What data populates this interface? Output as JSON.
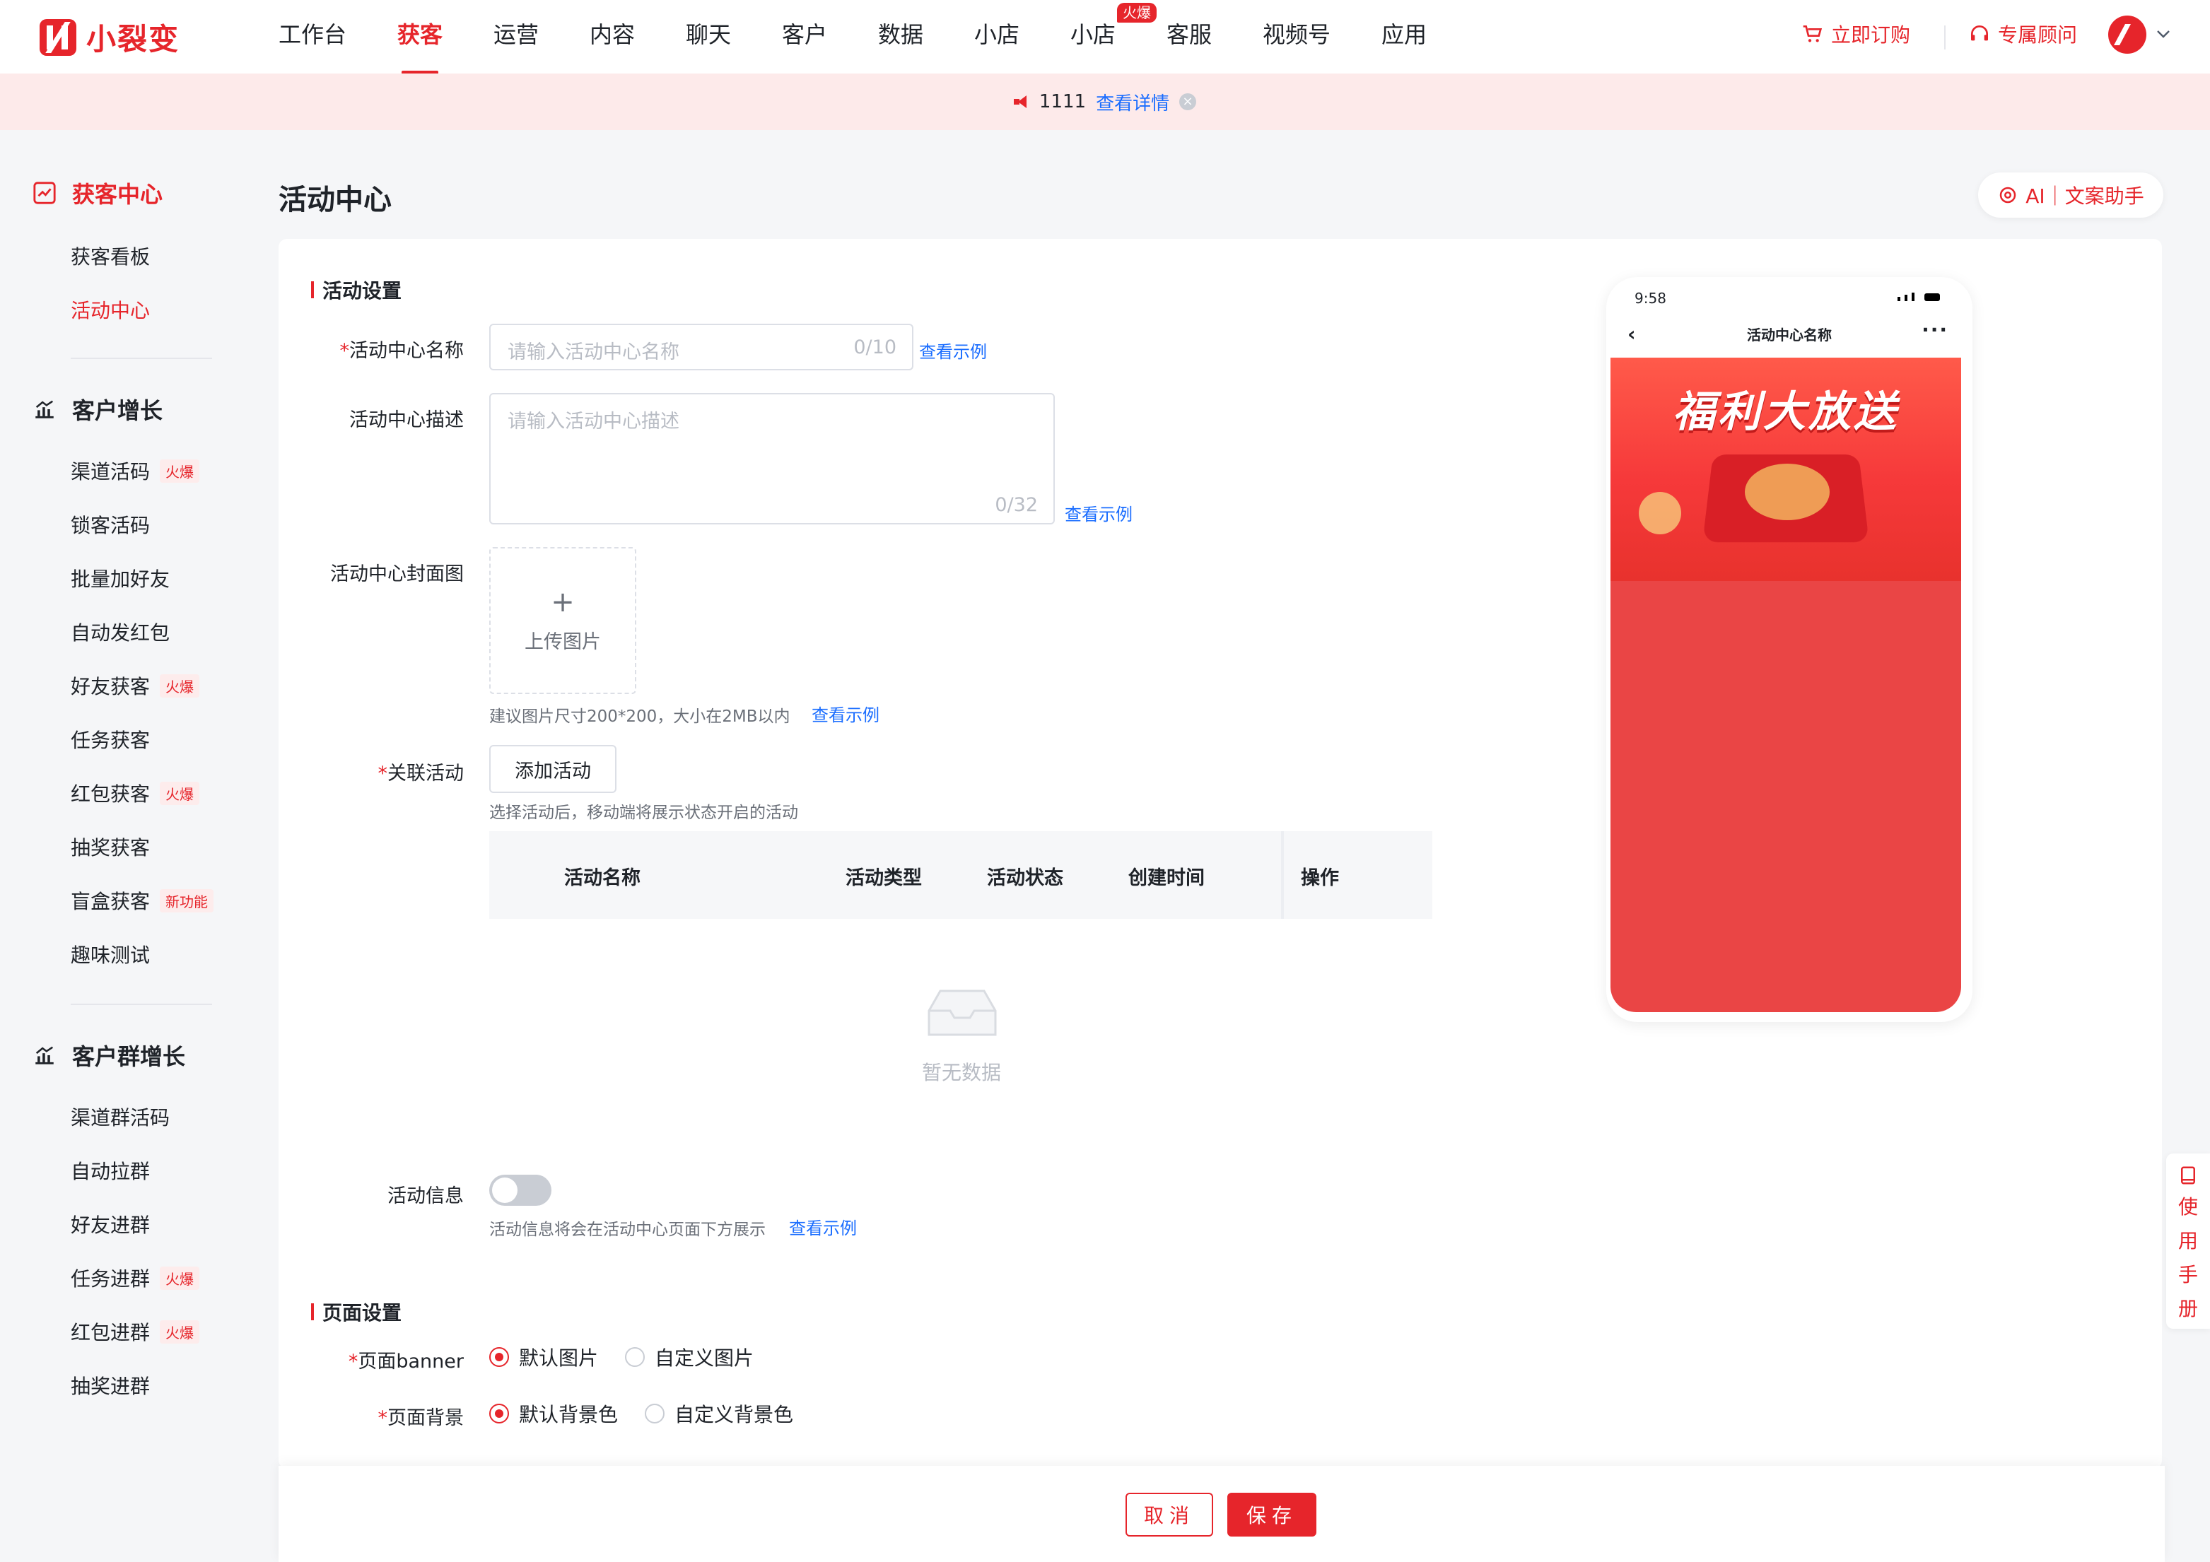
{
  "brand": {
    "name": "小裂变",
    "color": "#e6252b"
  },
  "nav": {
    "items": [
      "工作台",
      "获客",
      "运营",
      "内容",
      "聊天",
      "客户",
      "数据",
      "小店",
      "小店",
      "客服",
      "视频号",
      "应用"
    ],
    "active": "获客",
    "hot_badge": "火爆",
    "subscribe": "立即订购",
    "consultant": "专属顾问"
  },
  "notice": {
    "text": "1111",
    "link": "查看详情"
  },
  "sidebar": {
    "groups": [
      {
        "title": "获客中心",
        "items": [
          {
            "label": "获客看板"
          },
          {
            "label": "活动中心"
          }
        ]
      },
      {
        "title": "客户增长",
        "items": [
          {
            "label": "渠道活码",
            "tag": "火爆"
          },
          {
            "label": "锁客活码"
          },
          {
            "label": "批量加好友"
          },
          {
            "label": "自动发红包"
          },
          {
            "label": "好友获客",
            "tag": "火爆"
          },
          {
            "label": "任务获客"
          },
          {
            "label": "红包获客",
            "tag": "火爆"
          },
          {
            "label": "抽奖获客"
          },
          {
            "label": "盲盒获客",
            "tag": "新功能"
          },
          {
            "label": "趣味测试"
          }
        ]
      },
      {
        "title": "客户群增长",
        "items": [
          {
            "label": "渠道群活码"
          },
          {
            "label": "自动拉群"
          },
          {
            "label": "好友进群"
          },
          {
            "label": "任务进群",
            "tag": "火爆"
          },
          {
            "label": "红包进群",
            "tag": "火爆"
          },
          {
            "label": "抽奖进群"
          }
        ]
      }
    ]
  },
  "page": {
    "title": "活动中心",
    "ai_button": "AI｜文案助手",
    "activity_settings": {
      "section_title": "活动设置",
      "name_label": "活动中心名称",
      "name_placeholder": "请输入活动中心名称",
      "name_count": "0/10",
      "desc_label": "活动中心描述",
      "desc_placeholder": "请输入活动中心描述",
      "desc_count": "0/32",
      "example_link": "查看示例",
      "cover_label": "活动中心封面图",
      "upload_text": "上传图片",
      "cover_hint": "建议图片尺寸200*200，大小在2MB以内",
      "related_label": "关联活动",
      "add_button": "添加活动",
      "related_hint": "选择活动后，移动端将展示状态开启的活动",
      "table_headers": [
        "活动名称",
        "活动类型",
        "活动状态",
        "创建时间",
        "操作"
      ],
      "empty_text": "暂无数据",
      "info_label": "活动信息",
      "info_hint": "活动信息将会在活动中心页面下方展示"
    },
    "page_settings": {
      "section_title": "页面设置",
      "banner_label": "页面banner",
      "banner_options": [
        "默认图片",
        "自定义图片"
      ],
      "bg_label": "页面背景",
      "bg_options": [
        "默认背景色",
        "自定义背景色"
      ]
    },
    "preview": {
      "time": "9:58",
      "title": "活动中心名称",
      "banner_text": "福利大放送",
      "bg_color": "#ea4545"
    },
    "help": [
      "使",
      "用",
      "手",
      "册"
    ],
    "footer": {
      "cancel": "取消",
      "save": "保存"
    }
  }
}
